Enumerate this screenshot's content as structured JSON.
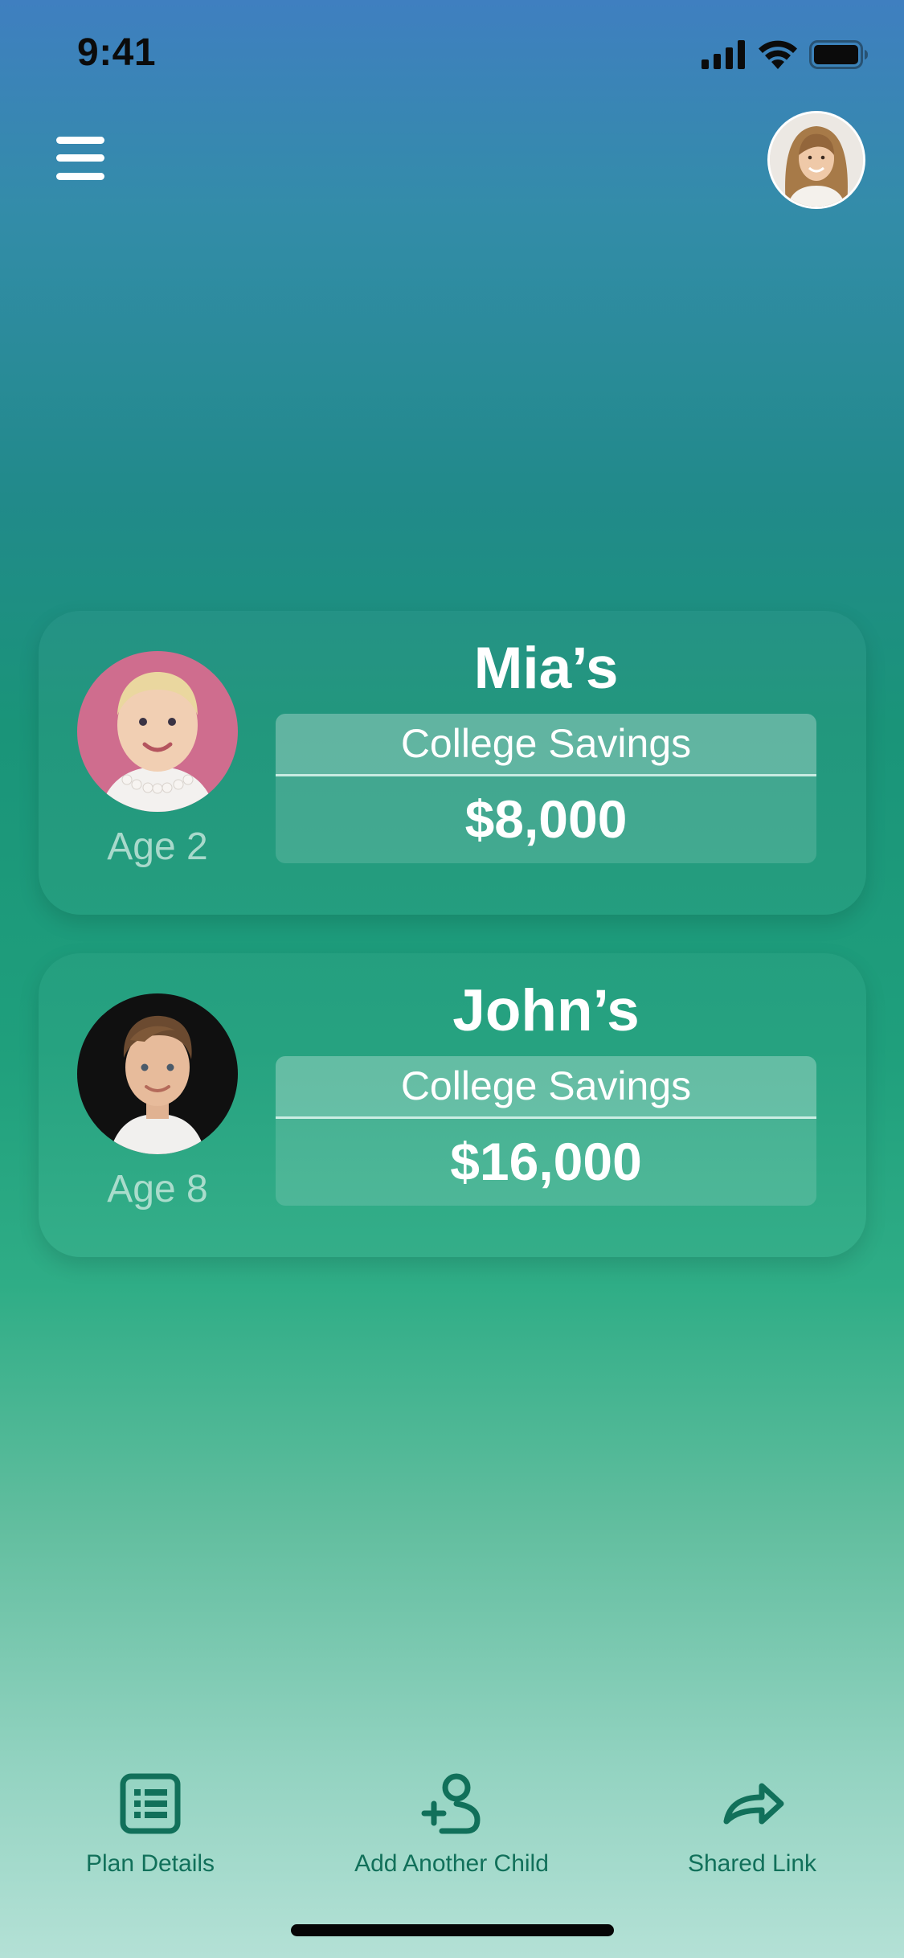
{
  "status_bar": {
    "time": "9:41"
  },
  "header": {
    "menu_icon": "hamburger-icon",
    "profile_avatar": "user-avatar"
  },
  "children": [
    {
      "name": "Mia’s",
      "age": "Age 2",
      "savings_label": "College Savings",
      "amount": "$8,000"
    },
    {
      "name": "John’s",
      "age": "Age 8",
      "savings_label": "College Savings",
      "amount": "$16,000"
    }
  ],
  "tab_bar": {
    "items": [
      {
        "label": "Plan Details",
        "icon": "list-document-icon"
      },
      {
        "label": "Add Another Child",
        "icon": "add-person-icon"
      },
      {
        "label": "Shared Link",
        "icon": "share-arrow-icon"
      }
    ]
  },
  "colors": {
    "gradient_top": "#3f7fc0",
    "gradient_mid": "#1a9479",
    "gradient_bottom": "#b4e1d6",
    "tab_accent": "#11705a",
    "text_primary": "#ffffff"
  }
}
